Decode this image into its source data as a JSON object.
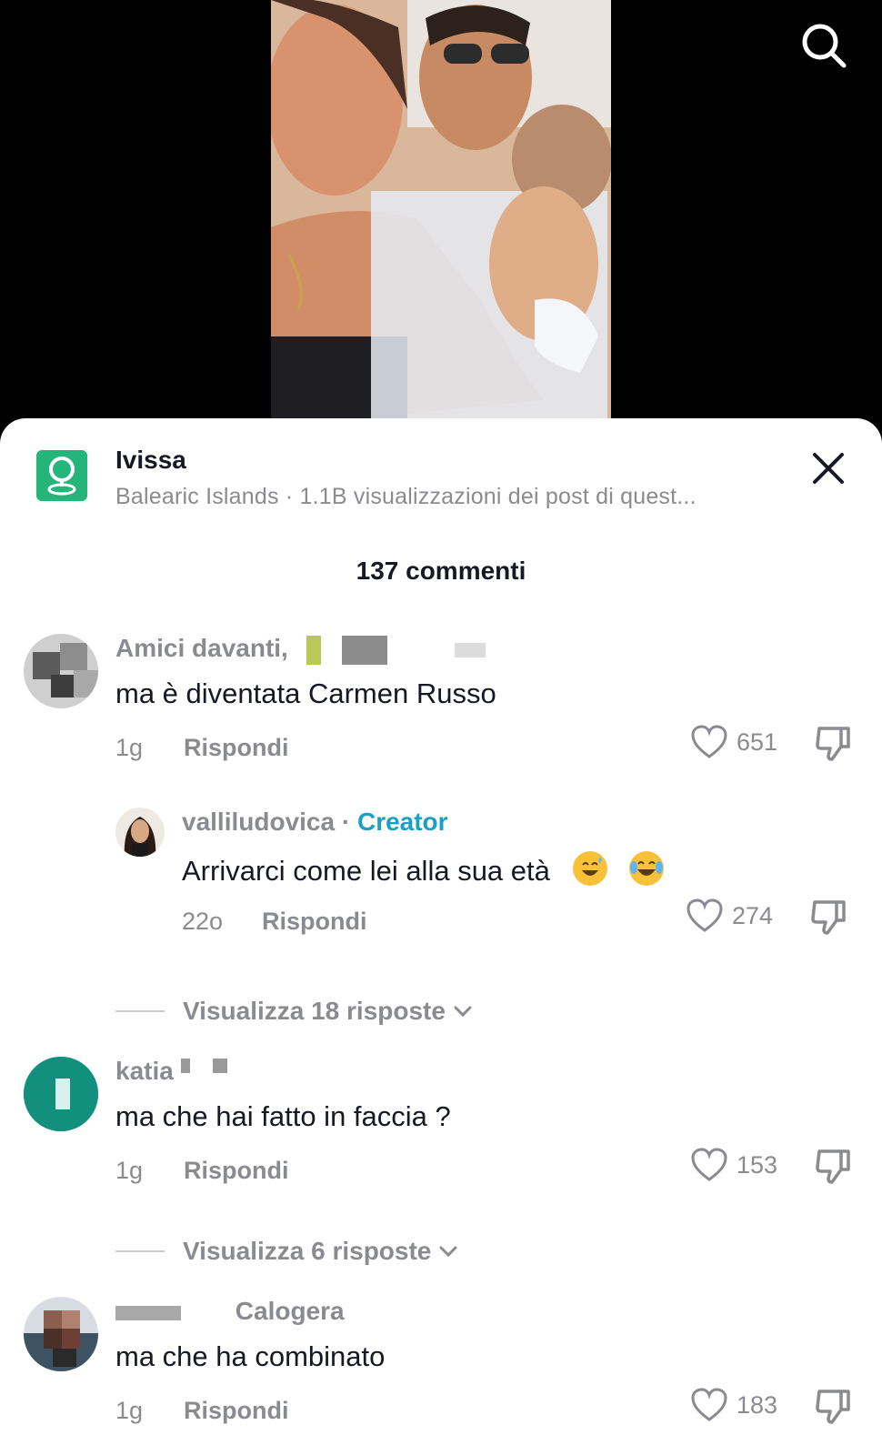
{
  "location": {
    "title": "Ivissa",
    "subtitle": "Balearic Islands · 1.1B visualizzazioni dei post di quest..."
  },
  "comments_header": "137 commenti",
  "comments": [
    {
      "username": "Amici davanti,",
      "text": "ma è diventata Carmen Russo",
      "time": "1g",
      "reply_label": "Rispondi",
      "likes": "651"
    },
    {
      "username": "valliludovica",
      "badge": "Creator",
      "text": "Arrivarci come lei alla sua età",
      "time": "22o",
      "reply_label": "Rispondi",
      "likes": "274",
      "emojis": [
        "sweat-smile-emoji",
        "tears-of-joy-emoji"
      ]
    },
    {
      "username": "katia",
      "text": "ma che hai fatto in faccia ?",
      "time": "1g",
      "reply_label": "Rispondi",
      "likes": "153"
    },
    {
      "username": "Calogera",
      "text": "ma che ha combinato",
      "time": "1g",
      "reply_label": "Rispondi",
      "likes": "183"
    }
  ],
  "view_replies": [
    "Visualizza 18 risposte",
    "Visualizza 6 risposte"
  ],
  "colors": {
    "accent_creator": "#1aa0c4",
    "location_icon": "#24b57a",
    "katia_avatar": "#138f7e",
    "muted_text": "#8a8b91"
  },
  "icons": [
    "search-icon",
    "location-pin-icon",
    "close-icon",
    "heart-icon",
    "dislike-icon",
    "chevron-down-icon"
  ]
}
